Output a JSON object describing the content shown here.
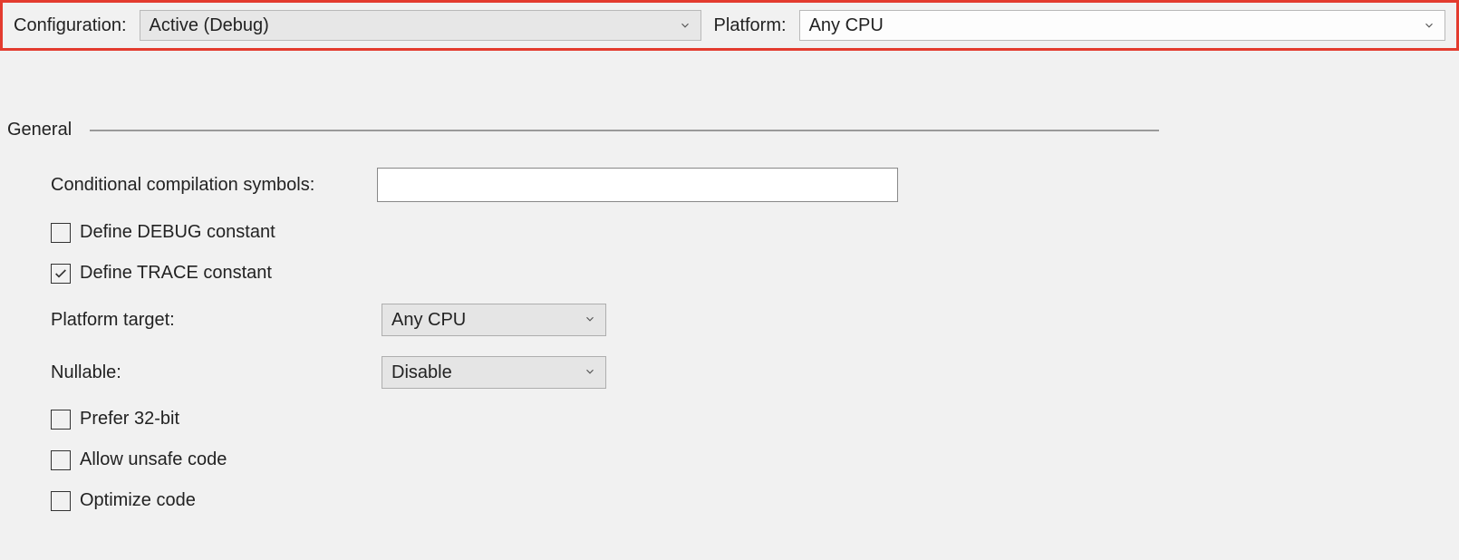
{
  "topbar": {
    "configuration_label": "Configuration:",
    "configuration_value": "Active (Debug)",
    "platform_label": "Platform:",
    "platform_value": "Any CPU"
  },
  "section": {
    "title": "General"
  },
  "fields": {
    "conditional_symbols_label": "Conditional compilation symbols:",
    "conditional_symbols_value": "",
    "define_debug_label": "Define DEBUG constant",
    "define_debug_checked": false,
    "define_trace_label": "Define TRACE constant",
    "define_trace_checked": true,
    "platform_target_label": "Platform target:",
    "platform_target_value": "Any CPU",
    "nullable_label": "Nullable:",
    "nullable_value": "Disable",
    "prefer_32bit_label": "Prefer 32-bit",
    "prefer_32bit_checked": false,
    "allow_unsafe_label": "Allow unsafe code",
    "allow_unsafe_checked": false,
    "optimize_code_label": "Optimize code",
    "optimize_code_checked": false
  }
}
